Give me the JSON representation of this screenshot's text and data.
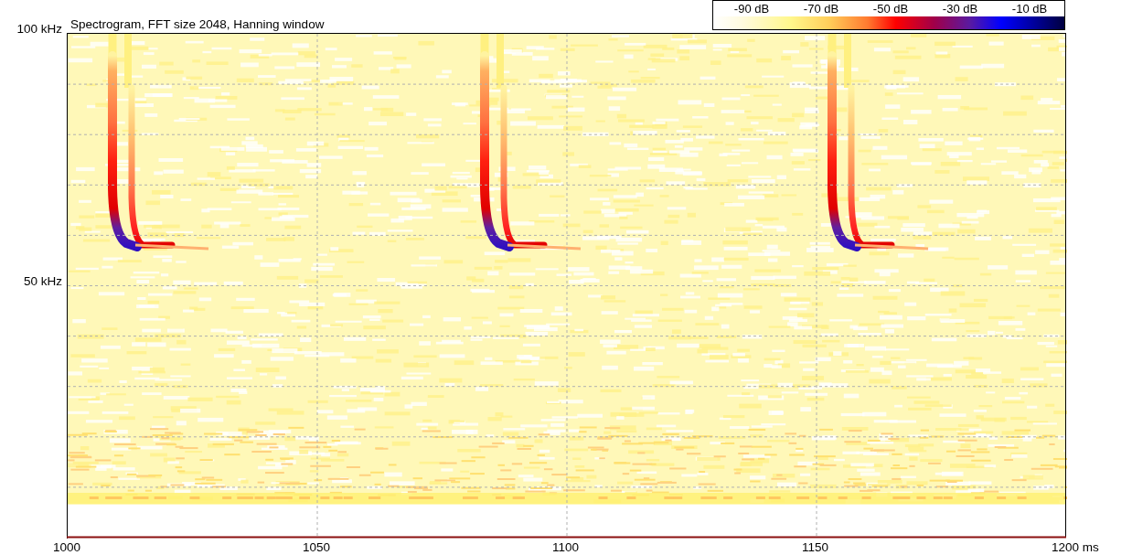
{
  "title": "Spectrogram, FFT size 2048, Hanning window",
  "color_scale": {
    "labels": [
      "-90 dB",
      "-70 dB",
      "-50 dB",
      "-30 dB",
      "-10 dB"
    ]
  },
  "y_axis": {
    "labels": [
      "100 kHz",
      "50 kHz"
    ]
  },
  "x_axis": {
    "labels": [
      "1000",
      "1050",
      "1100",
      "1150",
      "1200 ms"
    ]
  }
}
